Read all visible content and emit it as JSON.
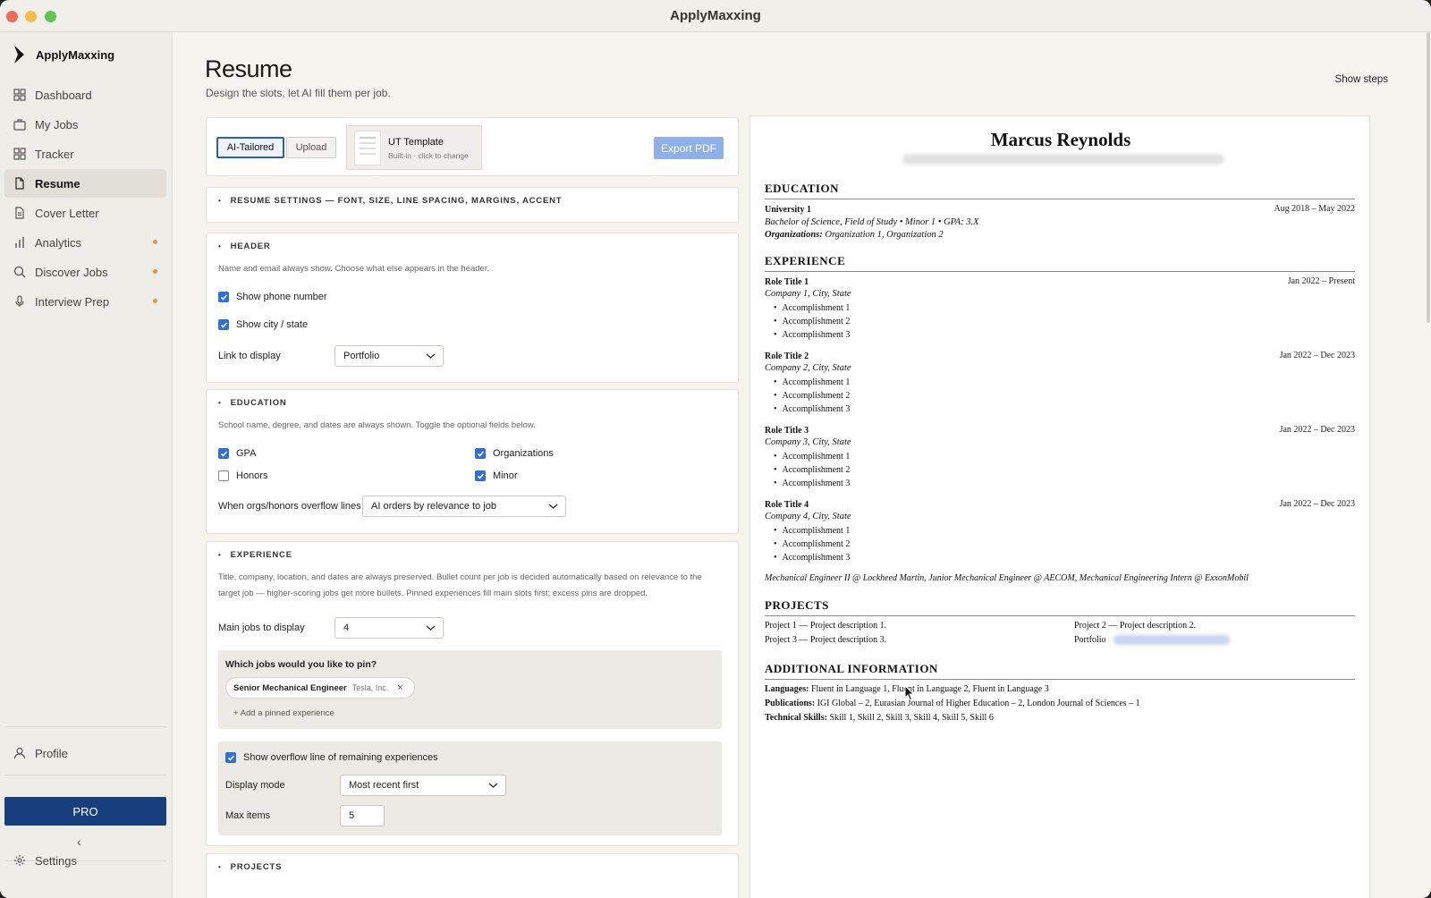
{
  "window": {
    "title": "ApplyMaxxing"
  },
  "sidebar": {
    "brand": "ApplyMaxxing",
    "items": [
      {
        "label": "Dashboard",
        "icon": "grid-icon"
      },
      {
        "label": "My Jobs",
        "icon": "briefcase-icon"
      },
      {
        "label": "Tracker",
        "icon": "board-icon"
      },
      {
        "label": "Resume",
        "icon": "document-icon",
        "active": true
      },
      {
        "label": "Cover Letter",
        "icon": "letter-icon"
      },
      {
        "label": "Analytics",
        "icon": "bar-chart-icon",
        "dot": true
      },
      {
        "label": "Discover Jobs",
        "icon": "search-icon",
        "dot": true
      },
      {
        "label": "Interview Prep",
        "icon": "microphone-icon",
        "dot": true
      }
    ],
    "profile": "Profile",
    "pro": "PRO",
    "collapse": "‹",
    "settings": "Settings"
  },
  "page": {
    "title": "Resume",
    "subtitle": "Design the slots, let AI fill them per job.",
    "show_steps": "Show steps"
  },
  "toolbar": {
    "ai_tailored": "AI-Tailored",
    "upload": "Upload",
    "template_name": "UT Template",
    "template_sub": "Built-in · click to change",
    "export": "Export PDF"
  },
  "settings_section": {
    "title": "RESUME SETTINGS — FONT, SIZE, LINE SPACING, MARGINS, ACCENT"
  },
  "header_section": {
    "title": "HEADER",
    "desc": "Name and email always show. Choose what else appears in the header.",
    "show_phone": "Show phone number",
    "show_city": "Show city / state",
    "link_label": "Link to display",
    "link_value": "Portfolio"
  },
  "education_section": {
    "title": "EDUCATION",
    "desc": "School name, degree, and dates are always shown. Toggle the optional fields below.",
    "gpa": "GPA",
    "organizations": "Organizations",
    "honors": "Honors",
    "minor": "Minor",
    "overflow_label": "When orgs/honors overflow lines",
    "overflow_value": "AI orders by relevance to job"
  },
  "experience_section": {
    "title": "EXPERIENCE",
    "desc_1": "Title, company, location, and dates are always preserved. Bullet count per job is decided automatically based on relevance to the",
    "desc_2": "target job — higher-scoring jobs get more bullets. Pinned experiences fill main slots first; excess pins are dropped.",
    "main_jobs_label": "Main jobs to display",
    "main_jobs_value": "4",
    "pin_question": "Which jobs would you like to pin?",
    "pin_title": "Senior Mechanical Engineer",
    "pin_company": "Tesla, Inc.",
    "pin_remove": "×",
    "add_pinned": "+ Add a pinned experience",
    "overflow_check": "Show overflow line of remaining experiences",
    "display_mode_label": "Display mode",
    "display_mode_value": "Most recent first",
    "max_items_label": "Max items",
    "max_items_value": "5"
  },
  "projects_section": {
    "title": "PROJECTS"
  },
  "preview": {
    "name": "Marcus Reynolds",
    "education_h": "EDUCATION",
    "university": "University 1",
    "edu_dates": "Aug 2018 – May 2022",
    "degree": "Bachelor of Science, Field of Study • Minor 1 • GPA: 3.X",
    "orgs_label": "Organizations:",
    "orgs_value": " Organization 1, Organization 2",
    "experience_h": "EXPERIENCE",
    "jobs": [
      {
        "role": "Role Title 1",
        "dates": "Jan 2022 – Present",
        "company": "Company 1, City, State",
        "bullets": [
          "Accomplishment 1",
          "Accomplishment 2",
          "Accomplishment 3"
        ]
      },
      {
        "role": "Role Title 2",
        "dates": "Jan 2022 – Dec 2023",
        "company": "Company 2, City, State",
        "bullets": [
          "Accomplishment 1",
          "Accomplishment 2",
          "Accomplishment 3"
        ]
      },
      {
        "role": "Role Title 3",
        "dates": "Jan 2022 – Dec 2023",
        "company": "Company 3, City, State",
        "bullets": [
          "Accomplishment 1",
          "Accomplishment 2",
          "Accomplishment 3"
        ]
      },
      {
        "role": "Role Title 4",
        "dates": "Jan 2022 – Dec 2023",
        "company": "Company 4, City, State",
        "bullets": [
          "Accomplishment 1",
          "Accomplishment 2",
          "Accomplishment 3"
        ]
      }
    ],
    "overflow_line": "Mechanical Engineer II @ Lockheed Martin, Junior Mechanical Engineer @ AECOM, Mechanical Engineering Intern @ ExxonMobil",
    "projects_h": "PROJECTS",
    "project_1": "Project 1 — Project description 1.",
    "project_2": "Project 2 — Project description 2.",
    "project_3": "Project 3 — Project description 3.",
    "portfolio": "Portfolio",
    "additional_h": "ADDITIONAL INFORMATION",
    "languages_label": "Languages:",
    "languages_value": " Fluent in Language 1, Fluent in Language 2, Fluent in Language 3",
    "publications_label": "Publications:",
    "publications_value": " IGI Global – 2, Eurasian Journal of Higher Education – 2, London Journal of Sciences – 1",
    "skills_label": "Technical Skills:",
    "skills_value": " Skill 1, Skill 2, Skill 3, Skill 4, Skill 5, Skill 6"
  },
  "colors": {
    "accent": "#2f6fd6",
    "pro": "#173f7d",
    "export": "#8fb0e6",
    "dot": "#e09a3c"
  }
}
